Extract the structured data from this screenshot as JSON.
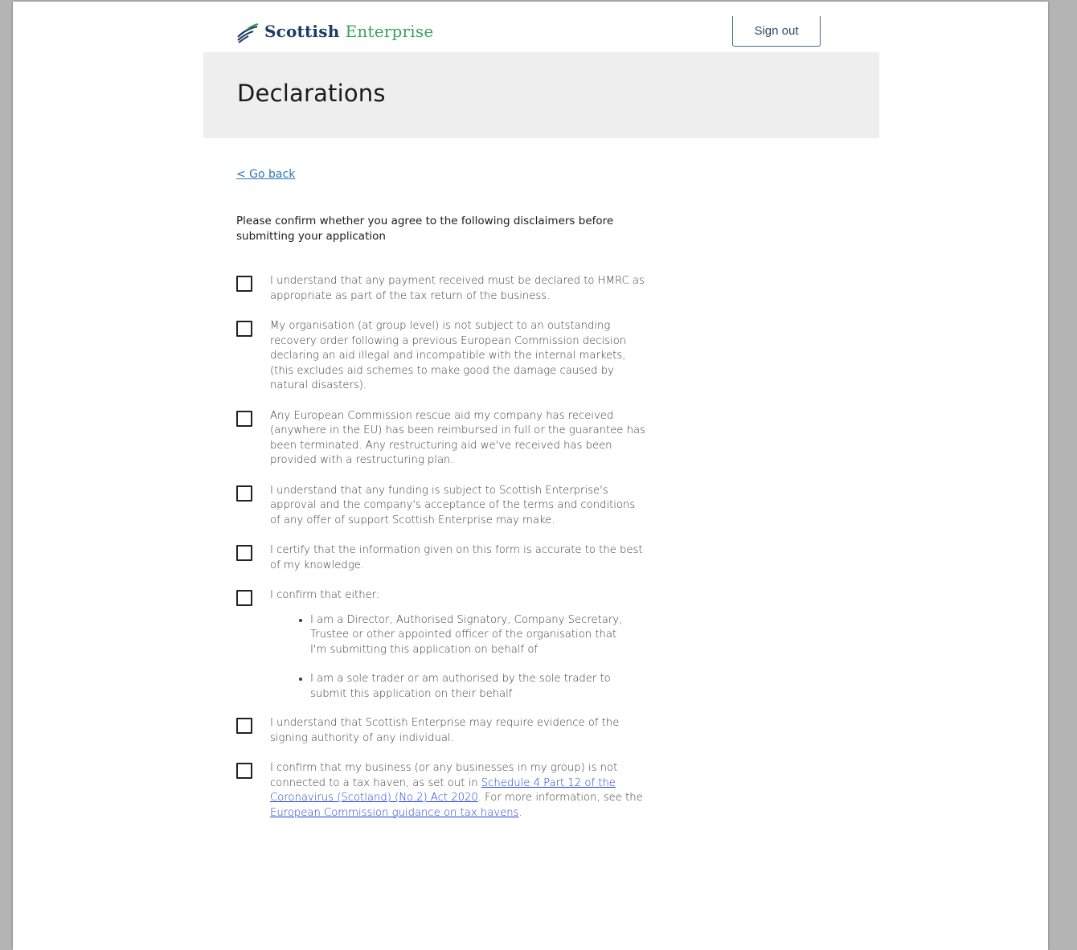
{
  "header": {
    "logo_word1": "Scottish",
    "logo_word2": "Enterprise",
    "signout_label": "Sign out"
  },
  "banner": {
    "title": "Declarations"
  },
  "nav": {
    "go_back": "< Go back"
  },
  "intro": "Please confirm whether you agree to the following disclaimers before submitting your application",
  "declarations": [
    {
      "text": "I understand that any payment received must be declared to HMRC as appropriate as part of the tax return of the business.",
      "checked": false
    },
    {
      "text": "My organisation (at group level) is not subject to an outstanding recovery order following a previous European Commission decision declaring an aid illegal and incompatible with the internal markets, (this excludes aid schemes to make good the damage caused by natural disasters).",
      "checked": false
    },
    {
      "text": "Any European Commission rescue aid my company has received (anywhere in the EU) has been reimbursed in full or the guarantee has been terminated. Any restructuring aid we've received has been provided with a restructuring plan.",
      "checked": false
    },
    {
      "text": "I understand that any funding is subject to Scottish Enterprise's approval and the company's acceptance of the terms and conditions of any offer of support Scottish Enterprise may make.",
      "checked": false
    },
    {
      "text": "I certify that the information given on this form is accurate to the best of my knowledge.",
      "checked": false
    },
    {
      "text": "I confirm that either:",
      "checked": false,
      "bullets": [
        "I am a Director, Authorised Signatory, Company Secretary, Trustee or other appointed officer of the organisation that I'm submitting this application on behalf of",
        "I am a sole trader or am authorised by the sole trader to submit this application on their behalf"
      ]
    },
    {
      "text": "I understand that Scottish Enterprise may require evidence of the signing authority of any individual.",
      "checked": false
    },
    {
      "checked": false,
      "part1": "I confirm that my business (or any businesses in my group) is not connected to a tax haven, as set out in ",
      "link1": "Schedule 4 Part 12 of the Coronavirus (Scotland) (No.2) Act 2020",
      "part2": ". For more information, see the ",
      "link2": "European Commission guidance on tax havens",
      "part3": "."
    }
  ],
  "colors": {
    "banner_bg": "#eeeeee",
    "link_blue": "#1a3fd6",
    "goback_blue": "#2a76b8",
    "logo_navy": "#1f3a68",
    "logo_green": "#3aa35c"
  }
}
